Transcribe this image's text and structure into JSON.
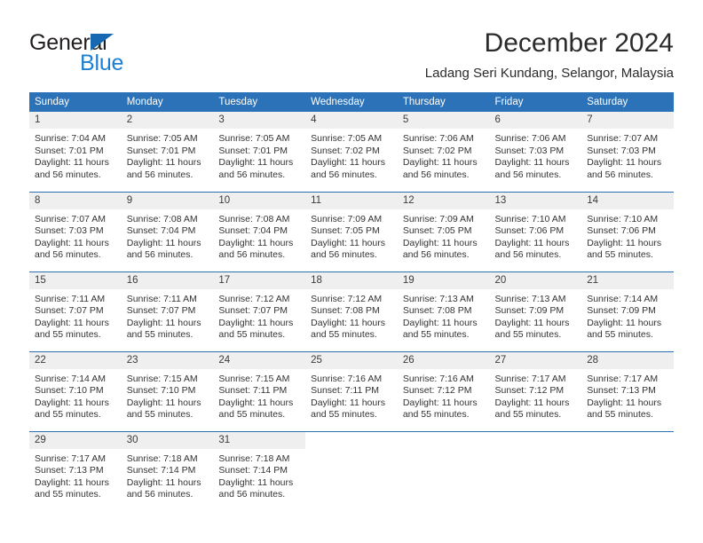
{
  "brand": {
    "name_top": "General",
    "name_bottom": "Blue",
    "color_dark": "#231f20",
    "color_blue": "#1d7fd1",
    "triangle_color": "#1668b3"
  },
  "header": {
    "title": "December 2024",
    "subtitle": "Ladang Seri Kundang, Selangor, Malaysia"
  },
  "theme": {
    "header_row_bg": "#2b72b8",
    "header_row_text": "#ffffff",
    "daynum_bg": "#efefef",
    "row_separator": "#2b6fb2",
    "body_text": "#333333"
  },
  "weekdays": [
    "Sunday",
    "Monday",
    "Tuesday",
    "Wednesday",
    "Thursday",
    "Friday",
    "Saturday"
  ],
  "labels": {
    "sunrise_prefix": "Sunrise:",
    "sunset_prefix": "Sunset:",
    "daylight_prefix": "Daylight:"
  },
  "weeks": [
    [
      {
        "day": "1",
        "sunrise": "Sunrise: 7:04 AM",
        "sunset": "Sunset: 7:01 PM",
        "daylight_1": "Daylight: 11 hours",
        "daylight_2": "and 56 minutes."
      },
      {
        "day": "2",
        "sunrise": "Sunrise: 7:05 AM",
        "sunset": "Sunset: 7:01 PM",
        "daylight_1": "Daylight: 11 hours",
        "daylight_2": "and 56 minutes."
      },
      {
        "day": "3",
        "sunrise": "Sunrise: 7:05 AM",
        "sunset": "Sunset: 7:01 PM",
        "daylight_1": "Daylight: 11 hours",
        "daylight_2": "and 56 minutes."
      },
      {
        "day": "4",
        "sunrise": "Sunrise: 7:05 AM",
        "sunset": "Sunset: 7:02 PM",
        "daylight_1": "Daylight: 11 hours",
        "daylight_2": "and 56 minutes."
      },
      {
        "day": "5",
        "sunrise": "Sunrise: 7:06 AM",
        "sunset": "Sunset: 7:02 PM",
        "daylight_1": "Daylight: 11 hours",
        "daylight_2": "and 56 minutes."
      },
      {
        "day": "6",
        "sunrise": "Sunrise: 7:06 AM",
        "sunset": "Sunset: 7:03 PM",
        "daylight_1": "Daylight: 11 hours",
        "daylight_2": "and 56 minutes."
      },
      {
        "day": "7",
        "sunrise": "Sunrise: 7:07 AM",
        "sunset": "Sunset: 7:03 PM",
        "daylight_1": "Daylight: 11 hours",
        "daylight_2": "and 56 minutes."
      }
    ],
    [
      {
        "day": "8",
        "sunrise": "Sunrise: 7:07 AM",
        "sunset": "Sunset: 7:03 PM",
        "daylight_1": "Daylight: 11 hours",
        "daylight_2": "and 56 minutes."
      },
      {
        "day": "9",
        "sunrise": "Sunrise: 7:08 AM",
        "sunset": "Sunset: 7:04 PM",
        "daylight_1": "Daylight: 11 hours",
        "daylight_2": "and 56 minutes."
      },
      {
        "day": "10",
        "sunrise": "Sunrise: 7:08 AM",
        "sunset": "Sunset: 7:04 PM",
        "daylight_1": "Daylight: 11 hours",
        "daylight_2": "and 56 minutes."
      },
      {
        "day": "11",
        "sunrise": "Sunrise: 7:09 AM",
        "sunset": "Sunset: 7:05 PM",
        "daylight_1": "Daylight: 11 hours",
        "daylight_2": "and 56 minutes."
      },
      {
        "day": "12",
        "sunrise": "Sunrise: 7:09 AM",
        "sunset": "Sunset: 7:05 PM",
        "daylight_1": "Daylight: 11 hours",
        "daylight_2": "and 56 minutes."
      },
      {
        "day": "13",
        "sunrise": "Sunrise: 7:10 AM",
        "sunset": "Sunset: 7:06 PM",
        "daylight_1": "Daylight: 11 hours",
        "daylight_2": "and 56 minutes."
      },
      {
        "day": "14",
        "sunrise": "Sunrise: 7:10 AM",
        "sunset": "Sunset: 7:06 PM",
        "daylight_1": "Daylight: 11 hours",
        "daylight_2": "and 55 minutes."
      }
    ],
    [
      {
        "day": "15",
        "sunrise": "Sunrise: 7:11 AM",
        "sunset": "Sunset: 7:07 PM",
        "daylight_1": "Daylight: 11 hours",
        "daylight_2": "and 55 minutes."
      },
      {
        "day": "16",
        "sunrise": "Sunrise: 7:11 AM",
        "sunset": "Sunset: 7:07 PM",
        "daylight_1": "Daylight: 11 hours",
        "daylight_2": "and 55 minutes."
      },
      {
        "day": "17",
        "sunrise": "Sunrise: 7:12 AM",
        "sunset": "Sunset: 7:07 PM",
        "daylight_1": "Daylight: 11 hours",
        "daylight_2": "and 55 minutes."
      },
      {
        "day": "18",
        "sunrise": "Sunrise: 7:12 AM",
        "sunset": "Sunset: 7:08 PM",
        "daylight_1": "Daylight: 11 hours",
        "daylight_2": "and 55 minutes."
      },
      {
        "day": "19",
        "sunrise": "Sunrise: 7:13 AM",
        "sunset": "Sunset: 7:08 PM",
        "daylight_1": "Daylight: 11 hours",
        "daylight_2": "and 55 minutes."
      },
      {
        "day": "20",
        "sunrise": "Sunrise: 7:13 AM",
        "sunset": "Sunset: 7:09 PM",
        "daylight_1": "Daylight: 11 hours",
        "daylight_2": "and 55 minutes."
      },
      {
        "day": "21",
        "sunrise": "Sunrise: 7:14 AM",
        "sunset": "Sunset: 7:09 PM",
        "daylight_1": "Daylight: 11 hours",
        "daylight_2": "and 55 minutes."
      }
    ],
    [
      {
        "day": "22",
        "sunrise": "Sunrise: 7:14 AM",
        "sunset": "Sunset: 7:10 PM",
        "daylight_1": "Daylight: 11 hours",
        "daylight_2": "and 55 minutes."
      },
      {
        "day": "23",
        "sunrise": "Sunrise: 7:15 AM",
        "sunset": "Sunset: 7:10 PM",
        "daylight_1": "Daylight: 11 hours",
        "daylight_2": "and 55 minutes."
      },
      {
        "day": "24",
        "sunrise": "Sunrise: 7:15 AM",
        "sunset": "Sunset: 7:11 PM",
        "daylight_1": "Daylight: 11 hours",
        "daylight_2": "and 55 minutes."
      },
      {
        "day": "25",
        "sunrise": "Sunrise: 7:16 AM",
        "sunset": "Sunset: 7:11 PM",
        "daylight_1": "Daylight: 11 hours",
        "daylight_2": "and 55 minutes."
      },
      {
        "day": "26",
        "sunrise": "Sunrise: 7:16 AM",
        "sunset": "Sunset: 7:12 PM",
        "daylight_1": "Daylight: 11 hours",
        "daylight_2": "and 55 minutes."
      },
      {
        "day": "27",
        "sunrise": "Sunrise: 7:17 AM",
        "sunset": "Sunset: 7:12 PM",
        "daylight_1": "Daylight: 11 hours",
        "daylight_2": "and 55 minutes."
      },
      {
        "day": "28",
        "sunrise": "Sunrise: 7:17 AM",
        "sunset": "Sunset: 7:13 PM",
        "daylight_1": "Daylight: 11 hours",
        "daylight_2": "and 55 minutes."
      }
    ],
    [
      {
        "day": "29",
        "sunrise": "Sunrise: 7:17 AM",
        "sunset": "Sunset: 7:13 PM",
        "daylight_1": "Daylight: 11 hours",
        "daylight_2": "and 55 minutes."
      },
      {
        "day": "30",
        "sunrise": "Sunrise: 7:18 AM",
        "sunset": "Sunset: 7:14 PM",
        "daylight_1": "Daylight: 11 hours",
        "daylight_2": "and 56 minutes."
      },
      {
        "day": "31",
        "sunrise": "Sunrise: 7:18 AM",
        "sunset": "Sunset: 7:14 PM",
        "daylight_1": "Daylight: 11 hours",
        "daylight_2": "and 56 minutes."
      },
      {
        "day": "",
        "sunrise": "",
        "sunset": "",
        "daylight_1": "",
        "daylight_2": ""
      },
      {
        "day": "",
        "sunrise": "",
        "sunset": "",
        "daylight_1": "",
        "daylight_2": ""
      },
      {
        "day": "",
        "sunrise": "",
        "sunset": "",
        "daylight_1": "",
        "daylight_2": ""
      },
      {
        "day": "",
        "sunrise": "",
        "sunset": "",
        "daylight_1": "",
        "daylight_2": ""
      }
    ]
  ]
}
